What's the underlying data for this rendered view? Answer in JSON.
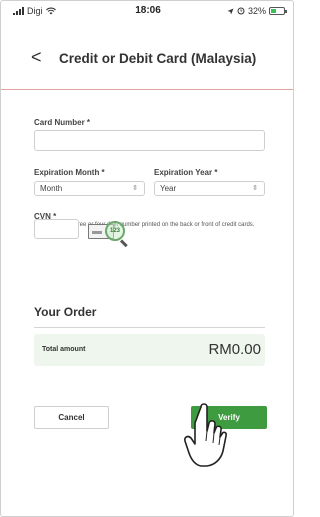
{
  "status_bar": {
    "carrier": "Digi",
    "time": "18:06",
    "battery": "32%",
    "icons": [
      "signal-icon",
      "wifi-icon",
      "location-icon",
      "alarm-icon",
      "battery-icon"
    ]
  },
  "header": {
    "back_glyph": "<",
    "title": "Credit or Debit Card (Malaysia)"
  },
  "form": {
    "card_number_label": "Card Number *",
    "card_number_value": "",
    "exp_month_label": "Expiration Month *",
    "exp_month_value": "Month",
    "exp_year_label": "Expiration Year *",
    "exp_year_value": "Year",
    "cvn_label": "CVN *",
    "cvn_hint": "This code is a three or four digit number printed on the back or front of credit cards.",
    "cvn_value": "",
    "cvn_card_number": "123"
  },
  "order": {
    "title": "Your Order",
    "total_label": "Total amount",
    "total_value": "RM0.00"
  },
  "buttons": {
    "cancel_label": "Cancel",
    "verify_label": "Verify"
  },
  "colors": {
    "accent_green": "#3f9b3f",
    "divider_red": "#e2a3a3",
    "total_bg": "#eef6ee"
  }
}
